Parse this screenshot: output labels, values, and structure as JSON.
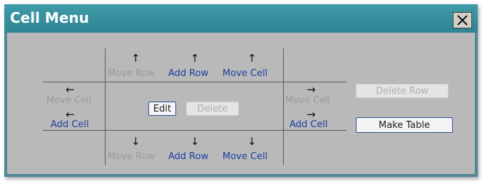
{
  "window": {
    "title": "Cell Menu",
    "close_icon": "close-x-icon"
  },
  "top": {
    "move_row": "Move Row",
    "add_row": "Add Row",
    "move_cell": "Move Cell",
    "arrow": "↑"
  },
  "bottom": {
    "move_row": "Move Row",
    "add_row": "Add Row",
    "move_cell": "Move Cell",
    "arrow": "↓"
  },
  "left": {
    "move_cell": "Move Cell",
    "add_cell": "Add Cell",
    "arrow": "←"
  },
  "right": {
    "move_cell": "Move Cell",
    "add_cell": "Add Cell",
    "arrow": "→"
  },
  "center": {
    "edit": "Edit",
    "delete": "Delete"
  },
  "actions": {
    "delete_row": "Delete Row",
    "make_table": "Make Table"
  },
  "colors": {
    "titlebar": "#2f8593",
    "panel": "#b9b9b9",
    "link": "#1c3fa0",
    "disabled": "#9a9a9a"
  }
}
